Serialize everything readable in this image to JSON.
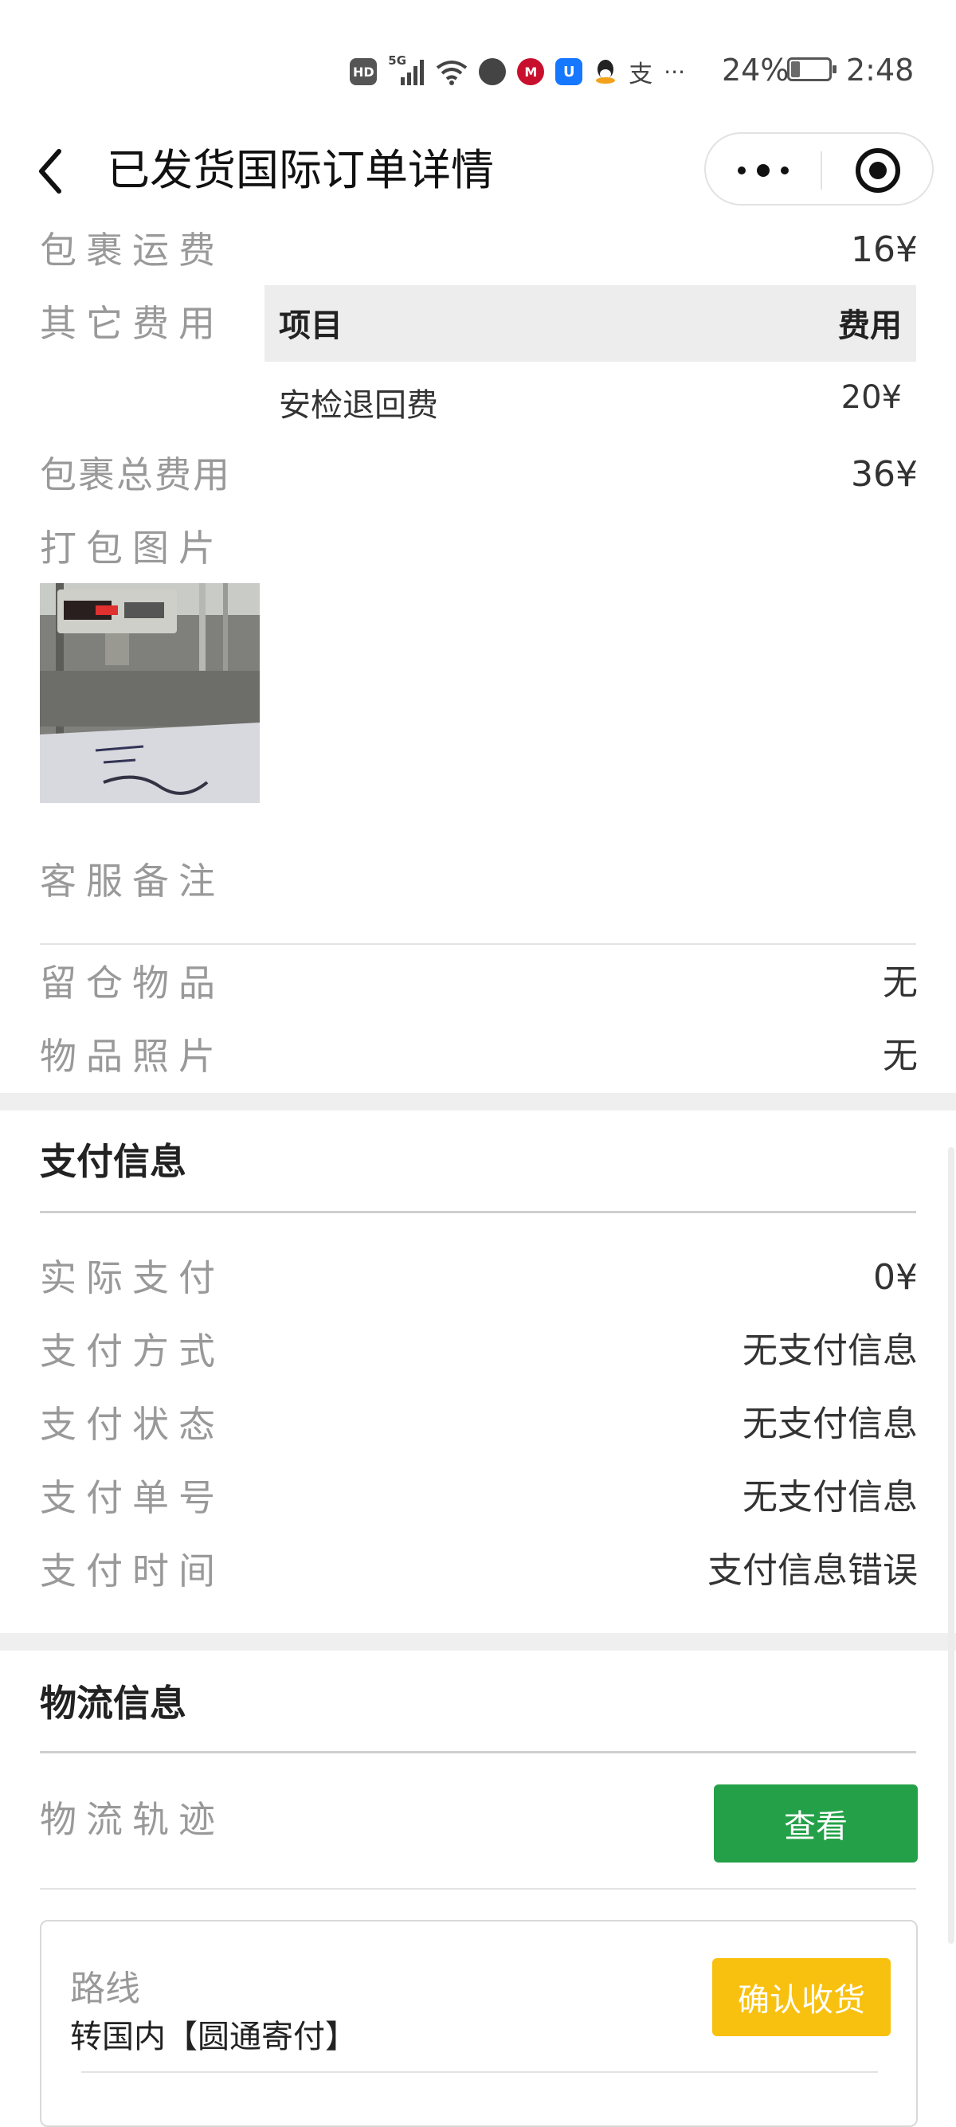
{
  "status_bar": {
    "hd": "HD",
    "network": "5G",
    "battery": "24%",
    "battery_level": 0.24,
    "time": "2:48",
    "more": "···",
    "alipay_glyph": "支"
  },
  "nav": {
    "title": "已发货国际订单详情"
  },
  "fees": {
    "parcel_freight_label": "包裹运费",
    "parcel_freight_value": "16¥",
    "other_fees_label": "其它费用",
    "table_headers": [
      "项目",
      "费用"
    ],
    "table_rows": [
      {
        "item": "安检退回费",
        "fee": "20¥"
      }
    ],
    "total_label": "包裹总费用",
    "total_value": "36¥",
    "packing_photo_label": "打包图片",
    "cs_note_label": "客服备注",
    "retained_items_label": "留仓物品",
    "retained_items_value": "无",
    "item_photos_label": "物品照片",
    "item_photos_value": "无"
  },
  "payment": {
    "section_title": "支付信息",
    "rows": [
      {
        "label": "实际支付",
        "value": "0¥"
      },
      {
        "label": "支付方式",
        "value": "无支付信息"
      },
      {
        "label": "支付状态",
        "value": "无支付信息"
      },
      {
        "label": "支付单号",
        "value": "无支付信息"
      },
      {
        "label": "支付时间",
        "value": "支付信息错误"
      }
    ]
  },
  "logistics": {
    "section_title": "物流信息",
    "track_label": "物流轨迹",
    "view_button": "查看",
    "route_label": "路线",
    "route_value": "转国内【圆通寄付】",
    "confirm_button": "确认收货"
  },
  "colors": {
    "green": "#24a148",
    "yellow": "#f8c10f"
  }
}
